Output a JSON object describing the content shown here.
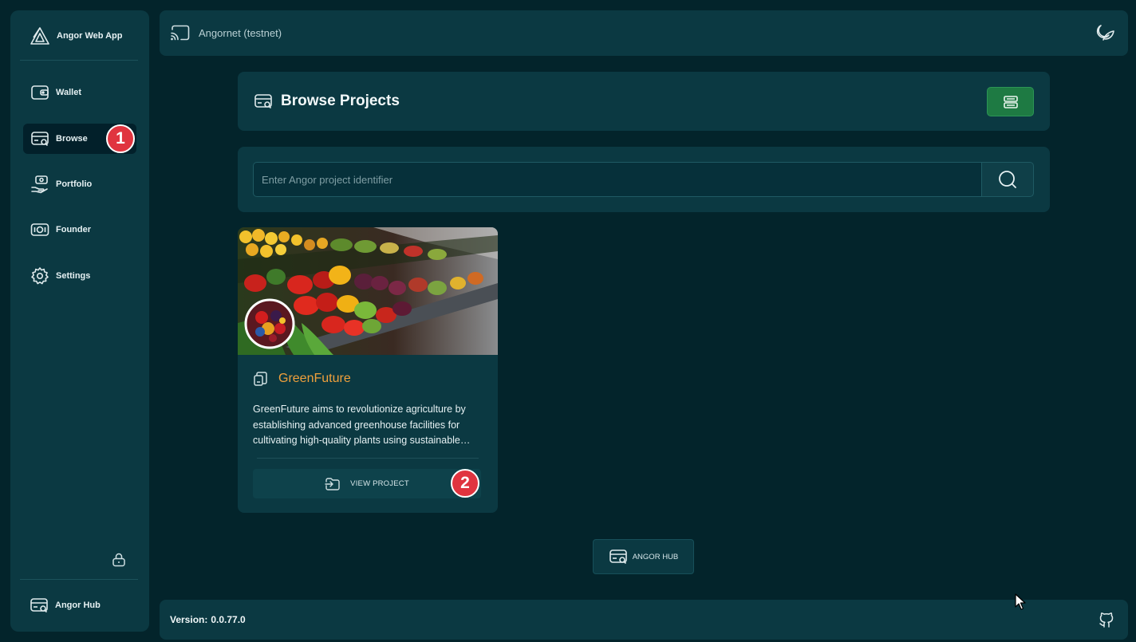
{
  "app": {
    "name": "Angor Web App"
  },
  "sidebar": {
    "items": [
      {
        "label": "Wallet",
        "icon": "wallet-icon"
      },
      {
        "label": "Browse",
        "icon": "browse-icon",
        "active": true
      },
      {
        "label": "Portfolio",
        "icon": "portfolio-icon"
      },
      {
        "label": "Founder",
        "icon": "founder-icon"
      },
      {
        "label": "Settings",
        "icon": "gear-icon"
      }
    ],
    "bottom_link": "Angor Hub"
  },
  "topbar": {
    "network": "Angornet (testnet)"
  },
  "page": {
    "title": "Browse Projects"
  },
  "search": {
    "placeholder": "Enter Angor project identifier",
    "value": ""
  },
  "project": {
    "name": "GreenFuture",
    "description": "GreenFuture aims to revolutionize agriculture by establishing advanced greenhouse facilities for cultivating high-quality plants using sustainable methods...",
    "button_label": "VIEW PROJECT"
  },
  "hub_button": {
    "label": "ANGOR HUB"
  },
  "footer": {
    "version_label": "Version:",
    "version": "0.0.77.0"
  },
  "annotations": {
    "badge_1": "1",
    "badge_2": "2"
  },
  "colors": {
    "background": "#03242b",
    "panel": "#0b3942",
    "accent_green": "#1e7a43",
    "project_name": "#f0a03c",
    "badge": "#e0343f"
  }
}
